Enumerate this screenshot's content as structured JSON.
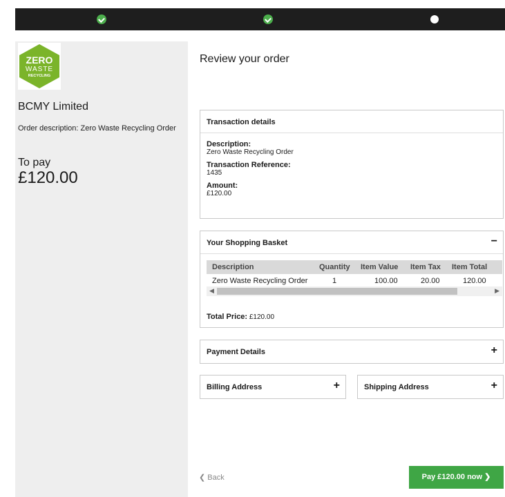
{
  "brand": {
    "logo_line1": "ZERO",
    "logo_line2": "WASTE",
    "logo_line3": "RECYCLING",
    "logo_color": "#7bb42a"
  },
  "sidebar": {
    "company_name": "BCMY Limited",
    "order_description": "Order description: Zero Waste Recycling Order",
    "to_pay_label": "To pay",
    "to_pay_amount": "£120.00"
  },
  "progress": {
    "steps": [
      {
        "state": "done",
        "icon": "check-icon"
      },
      {
        "state": "done",
        "icon": "check-icon"
      },
      {
        "state": "current",
        "icon": "dot-icon"
      }
    ],
    "colors": {
      "bar": "#1e1e1e",
      "done": "#4cae4c"
    }
  },
  "main": {
    "title": "Review your order",
    "transaction": {
      "heading": "Transaction details",
      "description_label": "Description:",
      "description_value": "Zero Waste Recycling Order",
      "reference_label": "Transaction Reference:",
      "reference_value": "1435",
      "amount_label": "Amount:",
      "amount_value": "£120.00"
    },
    "basket": {
      "heading": "Your Shopping Basket",
      "toggle": "−",
      "columns": [
        "Description",
        "Quantity",
        "Item Value",
        "Item Tax",
        "Item Total"
      ],
      "rows": [
        {
          "description": "Zero Waste Recycling Order",
          "quantity": "1",
          "item_value": "100.00",
          "item_tax": "20.00",
          "item_total": "120.00"
        }
      ],
      "total_label": "Total Price:",
      "total_value": "£120.00"
    },
    "payment_details": {
      "heading": "Payment Details",
      "toggle": "+"
    },
    "billing_address": {
      "heading": "Billing Address",
      "toggle": "+"
    },
    "shipping_address": {
      "heading": "Shipping Address",
      "toggle": "+"
    }
  },
  "footer": {
    "back_label": "Back",
    "pay_label": "Pay £120.00 now",
    "pay_color": "#3fa645"
  }
}
